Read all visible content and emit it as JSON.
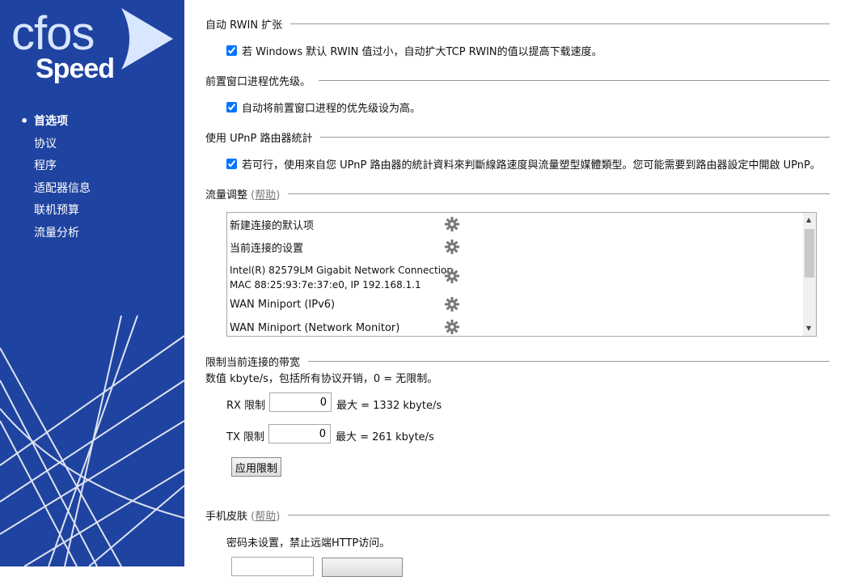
{
  "logo": {
    "line1": "cfos",
    "line2": "Speed"
  },
  "nav": [
    {
      "label": "首选项",
      "active": true
    },
    {
      "label": "协议"
    },
    {
      "label": "程序"
    },
    {
      "label": "适配器信息"
    },
    {
      "label": "联机预算"
    },
    {
      "label": "流量分析"
    }
  ],
  "sections": {
    "rwin": {
      "title": "自动 RWIN 扩张",
      "checkbox": "若 Windows 默认 RWIN 值过小，自动扩大TCP RWIN的值以提高下载速度。",
      "checked": true
    },
    "priority": {
      "title": "前置窗口进程优先级。",
      "checkbox": "自动将前置窗口进程的优先级设为高。",
      "checked": true
    },
    "upnp": {
      "title": "使用 UPnP 路由器統計",
      "checkbox": "若可行，使用來自您 UPnP 路由器的統計資料來判斷線路速度與流量塑型媒體類型。您可能需要到路由器設定中開啟 UPnP。",
      "checked": true
    },
    "traffic": {
      "title": "流量调整",
      "help_open": "(",
      "help": "帮助",
      "help_close": ")",
      "items": [
        {
          "line1": "新建连接的默认项",
          "line2": ""
        },
        {
          "line1": "当前连接的设置",
          "line2": ""
        },
        {
          "line1": "Intel(R) 82579LM Gigabit Network Connection",
          "line2": "MAC 88:25:93:7e:37:e0, IP 192.168.1.1"
        },
        {
          "line1": "WAN Miniport (IPv6)",
          "line2": ""
        },
        {
          "line1": "WAN Miniport (Network Monitor)",
          "line2": ""
        }
      ],
      "gear_icon": "gear-icon"
    },
    "limit": {
      "title": "限制当前连接的带宽",
      "desc": "数值 kbyte/s，包括所有协议开销，0 = 无限制。",
      "rx_label": "RX 限制",
      "rx_value": "0",
      "rx_max": "最大 = 1332 kbyte/s",
      "tx_label": "TX 限制",
      "tx_value": "0",
      "tx_max": "最大 = 261 kbyte/s",
      "apply_button": "应用限制"
    },
    "skin": {
      "title": "手机皮肤",
      "help_open": "(",
      "help": "帮助",
      "help_close": ")",
      "desc": "密码未设置，禁止远端HTTP访问。"
    }
  }
}
